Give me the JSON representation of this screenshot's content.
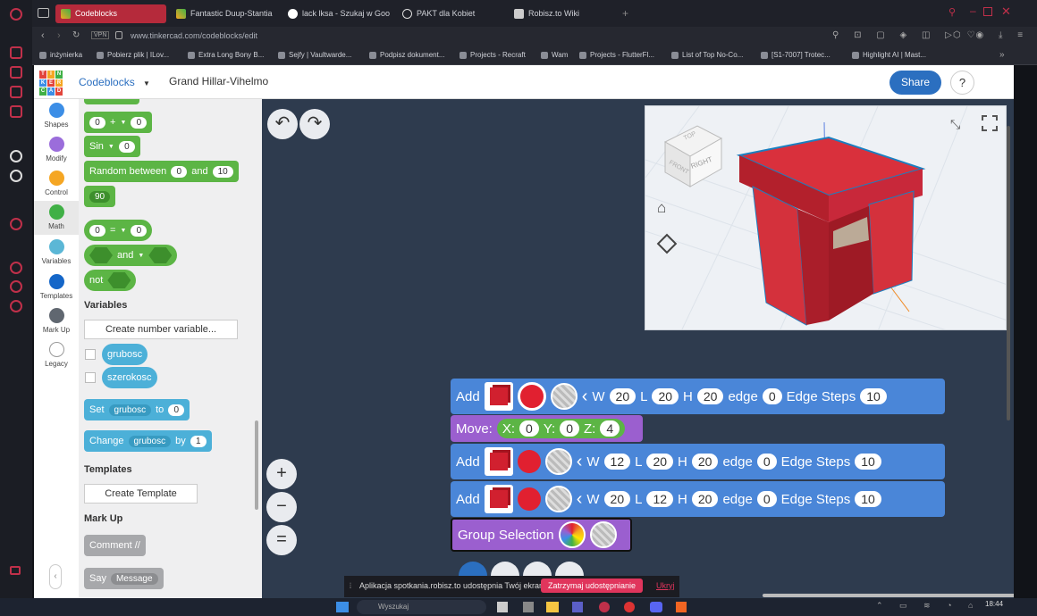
{
  "browser": {
    "tabs": [
      {
        "label": "Codeblocks",
        "active": true
      },
      {
        "label": "Fantastic Duup-Stantia",
        "active": false
      },
      {
        "label": "lack lksa - Szukaj w Goo",
        "active": false
      },
      {
        "label": "PAKT dla Kobiet",
        "active": false
      },
      {
        "label": "Robisz.to Wiki",
        "active": false
      }
    ],
    "vpn_label": "VPN",
    "url": "www.tinkercad.com/codeblocks/edit",
    "bookmarks": [
      "inżynierka",
      "Pobierz plik | ILov...",
      "Extra Long Bony B...",
      "Sejfy | Vaultwarde...",
      "Podpisz dokument...",
      "Projects - Recraft",
      "Wam",
      "Projects - FlutterFl...",
      "List of Top No-Co...",
      "[S1-7007] Trotec...",
      "Highlight AI | Mast..."
    ]
  },
  "app": {
    "logo_letters": [
      "T",
      "I",
      "N",
      "K",
      "E",
      "R",
      "C",
      "A",
      "D"
    ],
    "menu_label": "Codeblocks",
    "project_name": "Grand Hillar-Vihelmo",
    "share_label": "Share",
    "help_label": "?"
  },
  "categories": [
    {
      "label": "Shapes",
      "color": "#3c8ee6"
    },
    {
      "label": "Modify",
      "color": "#9b6ddb"
    },
    {
      "label": "Control",
      "color": "#f5a623"
    },
    {
      "label": "Math",
      "color": "#40b046"
    },
    {
      "label": "Variables",
      "color": "#5bb7d6"
    },
    {
      "label": "Templates",
      "color": "#1466c8"
    },
    {
      "label": "Mark Up",
      "color": "#606770"
    },
    {
      "label": "Legacy",
      "color": "#ffffff"
    }
  ],
  "palette": {
    "op_block": {
      "left": "0",
      "op": "+",
      "right": "0"
    },
    "sin_block": {
      "fn": "Sin",
      "value": "0"
    },
    "random_block": {
      "label": "Random between",
      "min": "0",
      "and": "and",
      "max": "10"
    },
    "number_block": "90",
    "compare_block": {
      "left": "0",
      "op": "=",
      "right": "0"
    },
    "and_block": "and",
    "not_block": "not",
    "variables_title": "Variables",
    "create_variable": "Create number variable...",
    "variables": [
      "grubosc",
      "szerokosc"
    ],
    "set_block": {
      "label": "Set",
      "var": "grubosc",
      "to": "to",
      "value": "0"
    },
    "change_block": {
      "label": "Change",
      "var": "grubosc",
      "by": "by",
      "value": "1"
    },
    "templates_title": "Templates",
    "create_template": "Create Template",
    "markup_title": "Mark Up",
    "comment_block": "Comment //",
    "say_block": {
      "label": "Say",
      "value": "Message"
    }
  },
  "workspace": {
    "add_blocks": [
      {
        "label": "Add",
        "w_label": "W",
        "w": "20",
        "l_label": "L",
        "l": "20",
        "h_label": "H",
        "h": "20",
        "edge_label": "edge",
        "edge": "0",
        "steps_label": "Edge Steps",
        "steps": "10"
      },
      {
        "label": "Add",
        "w_label": "W",
        "w": "12",
        "l_label": "L",
        "l": "20",
        "h_label": "H",
        "h": "20",
        "edge_label": "edge",
        "edge": "0",
        "steps_label": "Edge Steps",
        "steps": "10"
      },
      {
        "label": "Add",
        "w_label": "W",
        "w": "20",
        "l_label": "L",
        "l": "12",
        "h_label": "H",
        "h": "20",
        "edge_label": "edge",
        "edge": "0",
        "steps_label": "Edge Steps",
        "steps": "10"
      }
    ],
    "move_block": {
      "label": "Move:",
      "x_label": "X:",
      "x": "0",
      "y_label": "Y:",
      "y": "0",
      "z_label": "Z:",
      "z": "4"
    },
    "group_block": "Group Selection"
  },
  "viewcube": {
    "top": "TOP",
    "front": "FRONT",
    "right": "RIGHT"
  },
  "share_banner": {
    "text": "Aplikacja spotkania.robisz.to udostępnia Twój ekran.",
    "stop_label": "Zatrzymaj udostępnianie",
    "hide_label": "Ukryj"
  },
  "taskbar": {
    "search_placeholder": "Wyszukaj",
    "clock": "18:44"
  },
  "colors": {
    "accent": "#b52a3b",
    "share": "#2b6fc0",
    "add_block": "#4a86d8",
    "move_block": "#5cb545",
    "group_block": "#9b5fcf"
  }
}
